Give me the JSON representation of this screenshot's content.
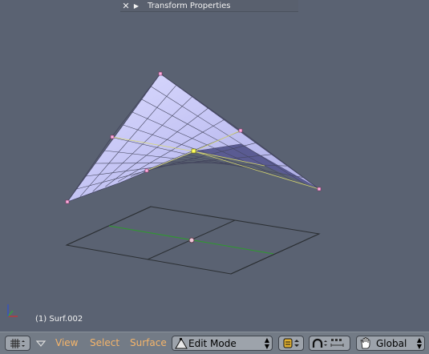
{
  "panel": {
    "close_glyph": "✕",
    "expand_glyph": "▶",
    "title": "Transform Properties"
  },
  "viewport": {
    "object_label": "(1) Surf.002"
  },
  "toolbar": {
    "menus": [
      "View",
      "Select",
      "Surface"
    ],
    "mode": "Edit Mode",
    "orientation": "Global",
    "icons": [
      "viewport-type-icon",
      "collapse-menu-icon",
      "draw-type-icon",
      "proportional-edit-icon",
      "snap-icon",
      "pan-hand-icon"
    ]
  },
  "colors": {
    "viewport_bg": "#5a6272",
    "menu_text": "#f6b56a",
    "surface": "#c8c8f8",
    "grid_axis_x": "#2e9a2e"
  }
}
